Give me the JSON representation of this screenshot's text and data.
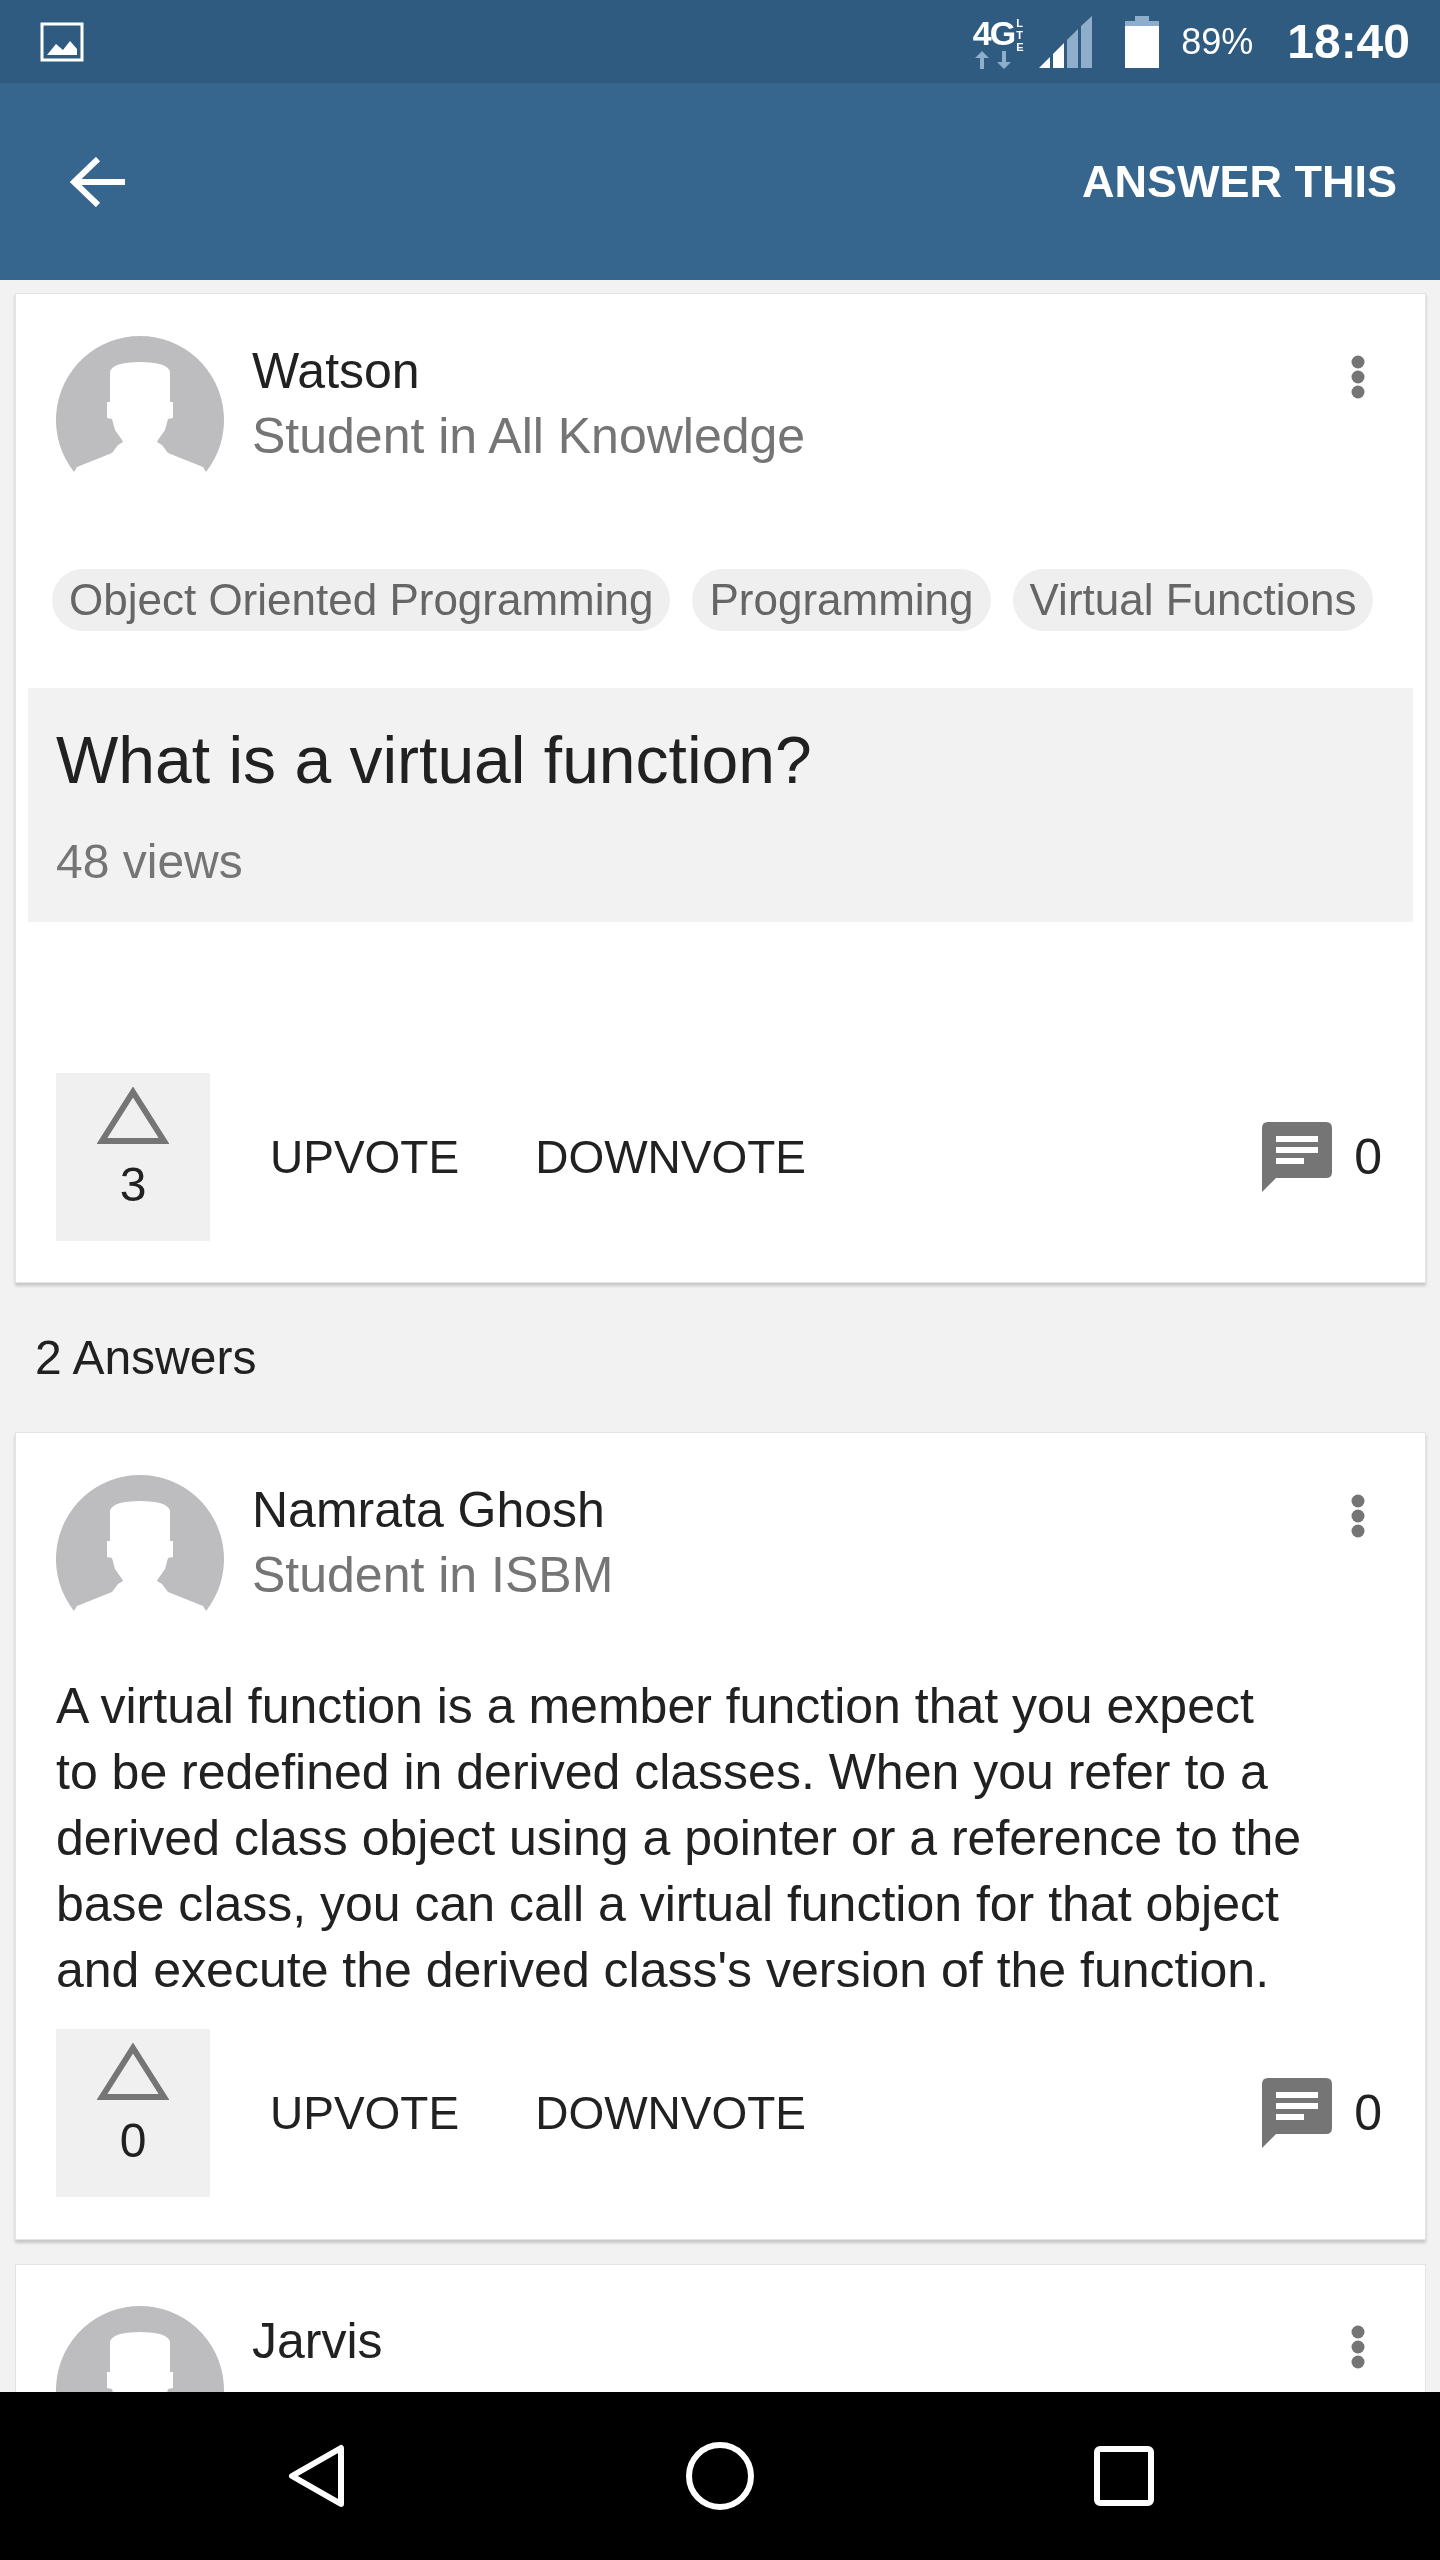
{
  "status_bar": {
    "network": "4G",
    "network_badge": "LTE",
    "battery": "89%",
    "time": "18:40"
  },
  "app_bar": {
    "action": "ANSWER THIS"
  },
  "question": {
    "author": {
      "name": "Watson",
      "subtitle": "Student in All Knowledge"
    },
    "tags": [
      "Object Oriented Programming",
      "Programming",
      "Virtual Functions"
    ],
    "title": "What is a virtual function?",
    "views": "48 views",
    "votes": "3",
    "actions": [
      "UPVOTE",
      "DOWNVOTE"
    ],
    "comments": "0"
  },
  "answers_heading": "2 Answers",
  "answers": [
    {
      "author": {
        "name": "Namrata Ghosh",
        "subtitle": "Student in ISBM"
      },
      "body": "A virtual function is a member function that you expect to be redefined in derived classes. When you refer to a derived class object using a pointer or a reference to the base class, you can call a virtual function for that object and execute the derived class's version of the function.",
      "votes": "0",
      "actions": [
        "UPVOTE",
        "DOWNVOTE"
      ],
      "comments": "0"
    },
    {
      "author": {
        "name": "Jarvis"
      }
    }
  ]
}
